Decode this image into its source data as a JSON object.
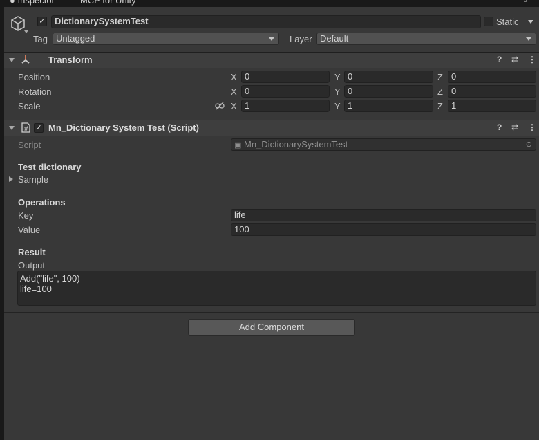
{
  "tabs": [
    {
      "label": "Inspector"
    },
    {
      "label": "MCP for Unity"
    }
  ],
  "gameobject": {
    "name": "DictionarySystemTest",
    "active": "✓",
    "static_label": "Static",
    "tag_label": "Tag",
    "tag_value": "Untagged",
    "layer_label": "Layer",
    "layer_value": "Default"
  },
  "transform": {
    "title": "Transform",
    "rows": [
      {
        "label": "Position",
        "x": "0",
        "y": "0",
        "z": "0"
      },
      {
        "label": "Rotation",
        "x": "0",
        "y": "0",
        "z": "0"
      },
      {
        "label": "Scale",
        "x": "1",
        "y": "1",
        "z": "1"
      }
    ],
    "axes": {
      "x": "X",
      "y": "Y",
      "z": "Z"
    }
  },
  "script_component": {
    "title": "Mn_Dictionary System Test (Script)",
    "enabled": "✓",
    "script_label": "Script",
    "script_value": "Mn_DictionarySystemTest",
    "test_dictionary_header": "Test dictionary",
    "sample_label": "Sample",
    "operations_header": "Operations",
    "key_label": "Key",
    "key_value": "life",
    "value_label": "Value",
    "value_value": "100",
    "result_header": "Result",
    "output_label": "Output",
    "output_value": "Add(\"life\", 100)\nlife=100"
  },
  "add_component_label": "Add Component",
  "icons": {
    "help": "?",
    "settings": "⇄",
    "menu": "⋮"
  },
  "colors": {
    "background": "#383838",
    "field": "#2a2a2a",
    "header": "#3e3e3e",
    "button": "#585858"
  }
}
